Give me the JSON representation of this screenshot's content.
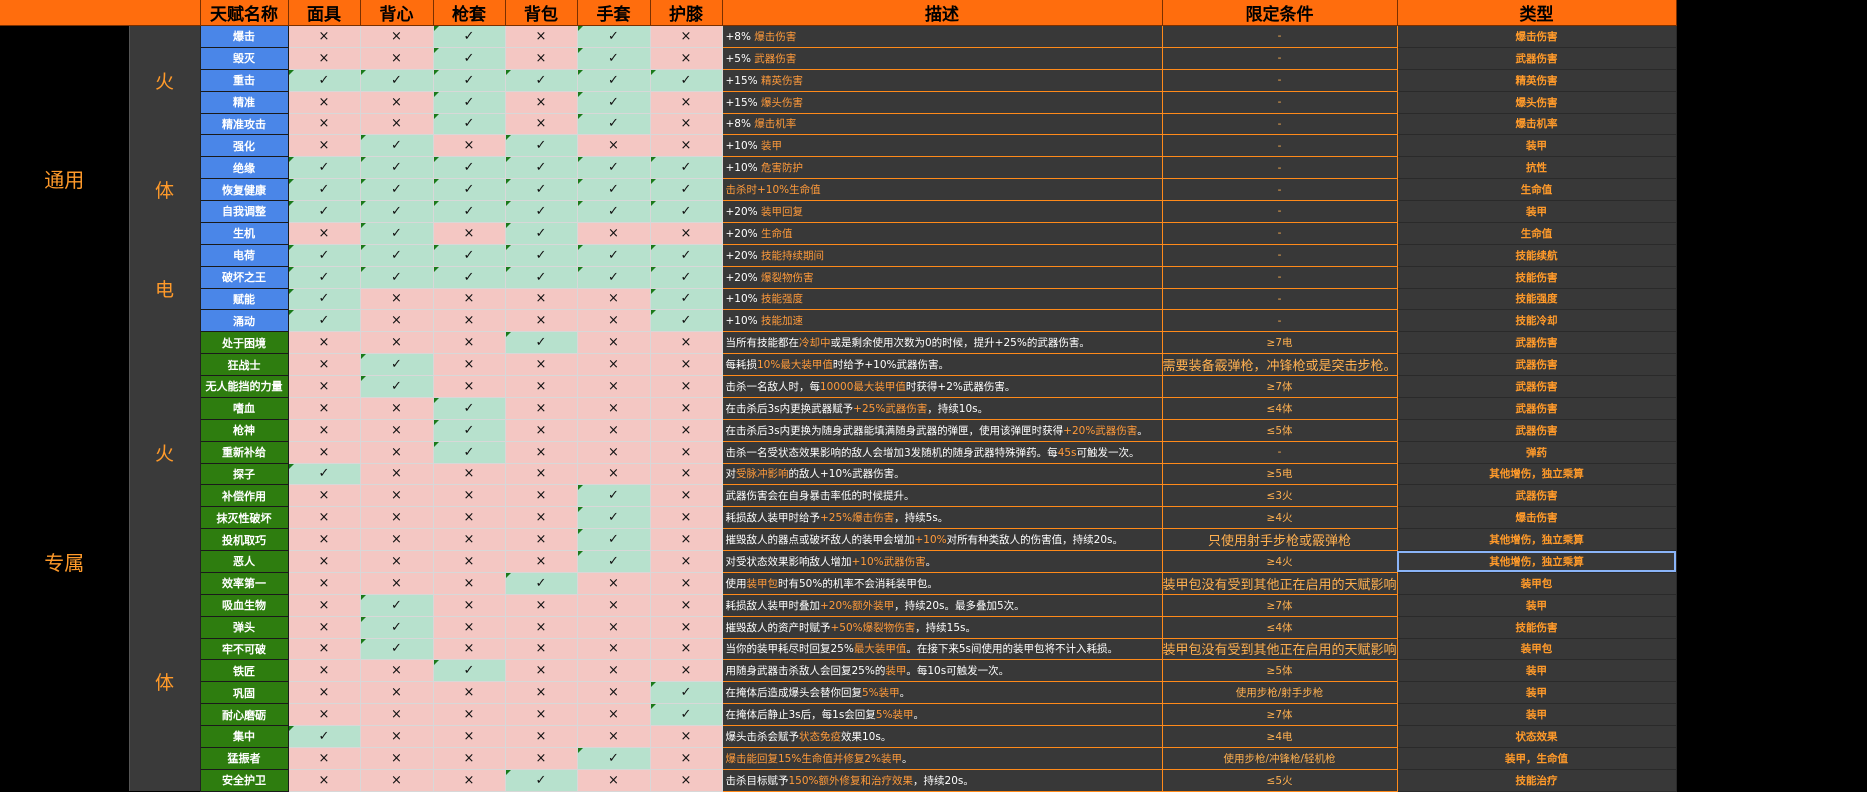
{
  "headers": [
    "天赋名称",
    "面具",
    "背心",
    "枪套",
    "背包",
    "手套",
    "护膝",
    "描述",
    "限定条件",
    "类型"
  ],
  "groups": {
    "general": "通用",
    "exclusive": "专属"
  },
  "subgroups": {
    "fire": "火",
    "body": "体",
    "elec": "电"
  },
  "marks": {
    "yes": "✓",
    "no": "×"
  },
  "rows": [
    {
      "name": "爆击",
      "pre": "+8% ",
      "hl": "爆击伤害",
      "post": "",
      "cond": "-",
      "type": "爆击伤害"
    },
    {
      "name": "毁灭",
      "pre": "+5% ",
      "hl": "武器伤害",
      "post": "",
      "cond": "-",
      "type": "武器伤害"
    },
    {
      "name": "重击",
      "pre": "+15% ",
      "hl": "精英伤害",
      "post": "",
      "cond": "-",
      "type": "精英伤害"
    },
    {
      "name": "精准",
      "pre": "+15% ",
      "hl": "爆头伤害",
      "post": "",
      "cond": "-",
      "type": "爆头伤害"
    },
    {
      "name": "精准攻击",
      "pre": "+8% ",
      "hl": "爆击机率",
      "post": "",
      "cond": "-",
      "type": "爆击机率"
    },
    {
      "name": "强化",
      "pre": "+10% ",
      "hl": "装甲",
      "post": "",
      "cond": "-",
      "type": "装甲"
    },
    {
      "name": "绝缘",
      "pre": "+10% ",
      "hl": "危害防护",
      "post": "",
      "cond": "-",
      "type": "抗性"
    },
    {
      "name": "恢复健康",
      "pre": "",
      "hl": "击杀时+10%生命值",
      "post": "",
      "cond": "-",
      "type": "生命值"
    },
    {
      "name": "自我调整",
      "pre": "+20% ",
      "hl": "装甲回复",
      "post": "",
      "cond": "-",
      "type": "装甲"
    },
    {
      "name": "生机",
      "pre": "+20% ",
      "hl": "生命值",
      "post": "",
      "cond": "-",
      "type": "生命值"
    },
    {
      "name": "电荷",
      "pre": "+20% ",
      "hl": "技能持续期间",
      "post": "",
      "cond": "-",
      "type": "技能续航"
    },
    {
      "name": "破坏之王",
      "pre": "+20% ",
      "hl": "爆裂物伤害",
      "post": "",
      "cond": "-",
      "type": "技能伤害"
    },
    {
      "name": "赋能",
      "pre": "+10% ",
      "hl": "技能强度",
      "post": "",
      "cond": "-",
      "type": "技能强度"
    },
    {
      "name": "涌动",
      "pre": "+10% ",
      "hl": "技能加速",
      "post": "",
      "cond": "-",
      "type": "技能冷却"
    },
    {
      "name": "处于困境",
      "pre": "当所有技能都在",
      "hl": "冷却中",
      "post": "或是剩余使用次数为0的时候，提升+25%的武器伤害。",
      "cond": "≥7电",
      "type": "武器伤害"
    },
    {
      "name": "狂战士",
      "pre": "每耗损",
      "hl": "10%最大装甲值",
      "post": "时给予+10%武器伤害。",
      "cond": "需要装备霰弹枪，冲锋枪或是突击步枪。",
      "type": "武器伤害"
    },
    {
      "name": "无人能挡的力量",
      "pre": "击杀一名敌人时，每",
      "hl": "10000最大装甲值",
      "post": "时获得+2%武器伤害。",
      "cond": "≥7体",
      "type": "武器伤害"
    },
    {
      "name": "嗜血",
      "pre": "在击杀后3s内更换武器赋予",
      "hl": "+25%武器伤害",
      "post": "，持续10s。",
      "cond": "≤4体",
      "type": "武器伤害"
    },
    {
      "name": "枪神",
      "pre": "在击杀后3s内更换为随身武器能填满随身武器的弹匣，使用该弹匣时获得",
      "hl": "+20%武器伤害",
      "post": "。",
      "cond": "≤5体",
      "type": "武器伤害"
    },
    {
      "name": "重新补给",
      "pre": "击杀一名受状态效果影响的敌人会增加3发随机的随身武器特殊弹药。每",
      "hl": "45s",
      "post": "可触发一次。",
      "cond": "-",
      "type": "弹药"
    },
    {
      "name": "探子",
      "pre": "对",
      "hl": "受脉冲影响",
      "post": "的敌人+10%武器伤害。",
      "cond": "≥5电",
      "type": "其他增伤，独立乘算"
    },
    {
      "name": "补偿作用",
      "pre": "武器伤害会在自身暴击率低的时候提升。",
      "hl": "",
      "post": "",
      "cond": "≤3火",
      "type": "武器伤害"
    },
    {
      "name": "抹灭性破坏",
      "pre": "耗损敌人装甲时给予",
      "hl": "+25%爆击伤害",
      "post": "，持续5s。",
      "cond": "≥4火",
      "type": "爆击伤害"
    },
    {
      "name": "投机取巧",
      "pre": "摧毁敌人的器点或破坏敌人的装甲会增加",
      "hl": "+10%",
      "post": "对所有种类敌人的伤害值，持续20s。",
      "cond": "只使用射手步枪或霰弹枪",
      "type": "其他增伤，独立乘算"
    },
    {
      "name": "恶人",
      "pre": "对受状态效果影响敌人增加",
      "hl": "+10%武器伤害",
      "post": "。",
      "cond": "≥4火",
      "type": "其他增伤，独立乘算"
    },
    {
      "name": "效率第一",
      "pre": "使用",
      "hl": "装甲包",
      "post": "时有50%的机率不会消耗装甲包。",
      "cond": "装甲包没有受到其他正在启用的天赋影响",
      "type": "装甲包"
    },
    {
      "name": "吸血生物",
      "pre": "耗损敌人装甲时叠加",
      "hl": "+20%额外装甲",
      "post": "，持续20s。最多叠加5次。",
      "cond": "≥7体",
      "type": "装甲"
    },
    {
      "name": "弹头",
      "pre": "摧毁敌人的资产时赋予",
      "hl": "+50%爆裂物伤害",
      "post": "，持续15s。",
      "cond": "≤4体",
      "type": "技能伤害"
    },
    {
      "name": "牢不可破",
      "pre": "当你的装甲耗尽时回复25%",
      "hl": "最大装甲值",
      "post": "。在接下来5s间使用的装甲包将不计入耗损。",
      "cond": "装甲包没有受到其他正在启用的天赋影响",
      "type": "装甲包"
    },
    {
      "name": "铁匠",
      "pre": "用随身武器击杀敌人会回复25%的",
      "hl": "装甲",
      "post": "。每10s可触发一次。",
      "cond": "≥5体",
      "type": "装甲"
    },
    {
      "name": "巩固",
      "pre": "在掩体后造成爆头会替你回复",
      "hl": "5%装甲",
      "post": "。",
      "cond": "使用步枪/射手步枪",
      "type": "装甲"
    },
    {
      "name": "耐心磨砺",
      "pre": "在掩体后静止3s后，每1s会回复",
      "hl": "5%装甲",
      "post": "。",
      "cond": "≥7体",
      "type": "装甲"
    },
    {
      "name": "集中",
      "pre": "爆头击杀会赋予",
      "hl": "状态免疫",
      "post": "效果10s。",
      "cond": "≥4电",
      "type": "状态效果"
    },
    {
      "name": "猛振者",
      "pre": "",
      "hl": "爆击能回复15%生命值并修复2%装甲",
      "post": "。",
      "cond": "使用步枪/冲锋枪/轻机枪",
      "type": "装甲，生命值"
    },
    {
      "name": "安全护卫",
      "pre": "击杀目标赋予",
      "hl": "150%额外修复和治疗效果",
      "post": "，持续20s。",
      "cond": "≤5火",
      "type": "技能治疗"
    }
  ]
}
